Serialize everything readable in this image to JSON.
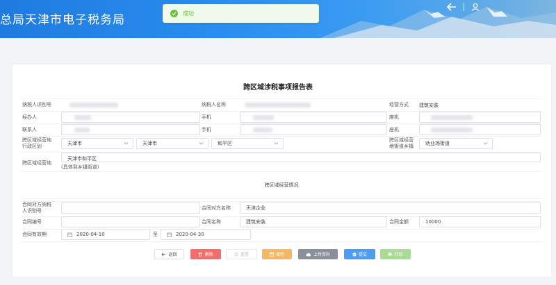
{
  "header": {
    "brand": "总局天津市电子税务局",
    "icons": [
      "back-arrow-icon",
      "user-icon"
    ]
  },
  "toast": {
    "text": "成功",
    "icon": "success-check-icon",
    "color": "#67c23a"
  },
  "form": {
    "title": "跨区域涉税事项报告表",
    "labels": {
      "taxpayer_id": "纳税人识别号",
      "taxpayer_name": "纳税人名称",
      "business_mode": "经营方式",
      "handler": "经办人",
      "phone1": "手机",
      "landline1": "座机",
      "contact": "联系人",
      "phone2": "手机",
      "landline2": "座机",
      "region_line1": "跨区域经营地",
      "region_line2": "行政区划",
      "street_line1": "跨区域经营",
      "street_line2": "地街道乡镇",
      "address": "跨区域经营地",
      "address_hint": "(具体到乡镇街道)",
      "section": "跨区域经营情况",
      "counterparty_id_line1": "合同对方纳税",
      "counterparty_id_line2": "人识别号",
      "counterparty_name": "合同对方名称",
      "contract_no": "合同编号",
      "contract_name": "合同名称",
      "contract_amount": "合同金额",
      "validity": "合同有效期",
      "to": "至"
    },
    "values": {
      "business_mode": "建筑安装",
      "province": "天津市",
      "city": "天津市",
      "district": "和平区",
      "street": "劝业场街道",
      "address": "天津市和平区",
      "counterparty_name": "天津企业",
      "contract_name": "建筑安装",
      "contract_amount": "10000",
      "start_date": "2020-04-10",
      "end_date": "2020-04-30"
    }
  },
  "buttons": {
    "back": "返回",
    "delete": "删除",
    "reset": "重置",
    "save": "保存",
    "upload": "上传资料",
    "submit": "提交",
    "print": "打印"
  }
}
